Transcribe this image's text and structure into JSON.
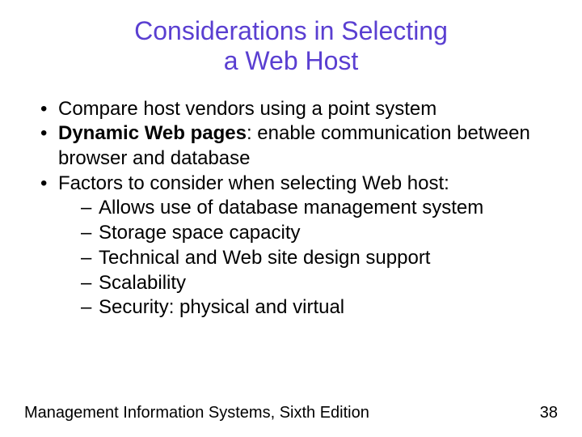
{
  "title_line1": "Considerations in Selecting",
  "title_line2": "a Web Host",
  "bullets": {
    "b1": "Compare host vendors using a point system",
    "b2_bold": "Dynamic Web pages",
    "b2_rest": ": enable communication between browser and database",
    "b3": "Factors to consider when selecting Web host:",
    "sub1": "Allows use of database management system",
    "sub2": "Storage space capacity",
    "sub3": "Technical and Web site design support",
    "sub4": "Scalability",
    "sub5": "Security: physical and virtual"
  },
  "footer": "Management Information Systems, Sixth Edition",
  "page_number": "38"
}
